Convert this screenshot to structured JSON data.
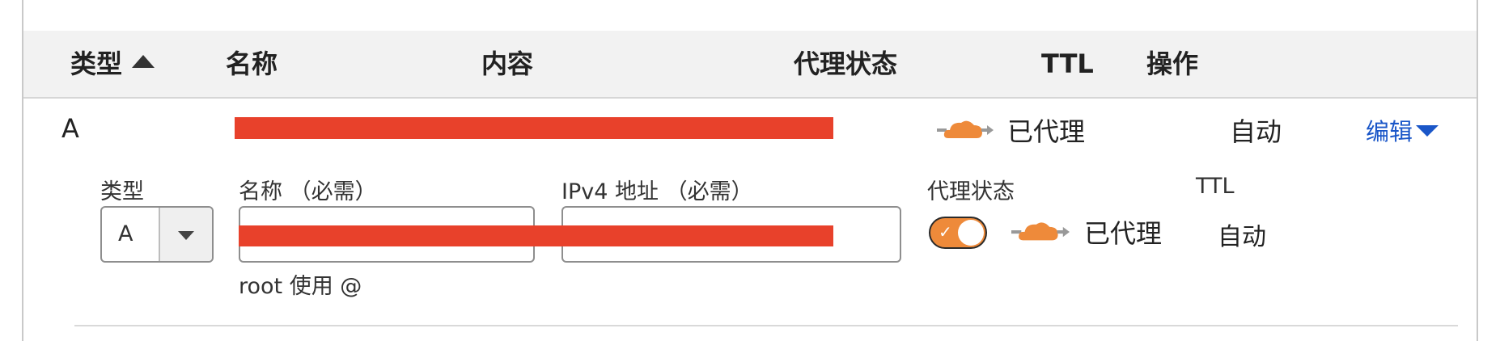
{
  "table": {
    "headers": {
      "type": "类型",
      "name": "名称",
      "content": "内容",
      "proxy_status": "代理状态",
      "ttl": "TTL",
      "actions": "操作"
    },
    "row": {
      "type": "A",
      "proxy_status": "已代理",
      "ttl": "自动",
      "edit_label": "编辑"
    }
  },
  "edit_form": {
    "type_label": "类型",
    "type_value": "A",
    "name_label": "名称 （必需）",
    "name_hint": "root 使用 @",
    "ipv4_label": "IPv4 地址 （必需）",
    "proxy_label": "代理状态",
    "proxy_value": "已代理",
    "ttl_label": "TTL",
    "ttl_value": "自动"
  },
  "colors": {
    "cloud_orange": "#ee8a3a",
    "link_blue": "#1a56c8",
    "redaction": "#e8412b"
  }
}
